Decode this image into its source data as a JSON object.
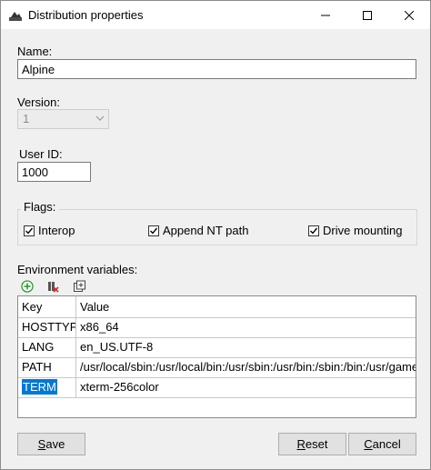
{
  "window": {
    "title": "Distribution properties"
  },
  "form": {
    "name_label": "Name:",
    "name_value": "Alpine",
    "version_label": "Version:",
    "version_value": "1",
    "userid_label": "User ID:",
    "userid_value": "1000",
    "flags_label": "Flags:",
    "flags": [
      {
        "label": "Interop",
        "checked": true
      },
      {
        "label": "Append NT path",
        "checked": true
      },
      {
        "label": "Drive mounting",
        "checked": true
      }
    ],
    "env_label": "Environment variables:"
  },
  "grid": {
    "columns": [
      "Key",
      "Value"
    ],
    "rows": [
      {
        "key": "HOSTTYPE",
        "value": "x86_64"
      },
      {
        "key": "LANG",
        "value": "en_US.UTF-8"
      },
      {
        "key": "PATH",
        "value": "/usr/local/sbin:/usr/local/bin:/usr/sbin:/usr/bin:/sbin:/bin:/usr/games:"
      },
      {
        "key": "TERM",
        "value": "xterm-256color"
      }
    ]
  },
  "buttons": {
    "save_key": "S",
    "save_rest": "ave",
    "reset_key": "R",
    "reset_rest": "eset",
    "cancel_key": "C",
    "cancel_rest": "ancel"
  },
  "icons": {
    "app": "distro-icon",
    "add": "add-icon",
    "delete": "delete-icon",
    "duplicate": "duplicate-icon",
    "minimize": "minimize-icon",
    "maximize": "maximize-icon",
    "close": "close-icon"
  },
  "colors": {
    "selection": "#0078d7",
    "add_green": "#2d9b2d",
    "delete_red": "#d42a2a"
  }
}
